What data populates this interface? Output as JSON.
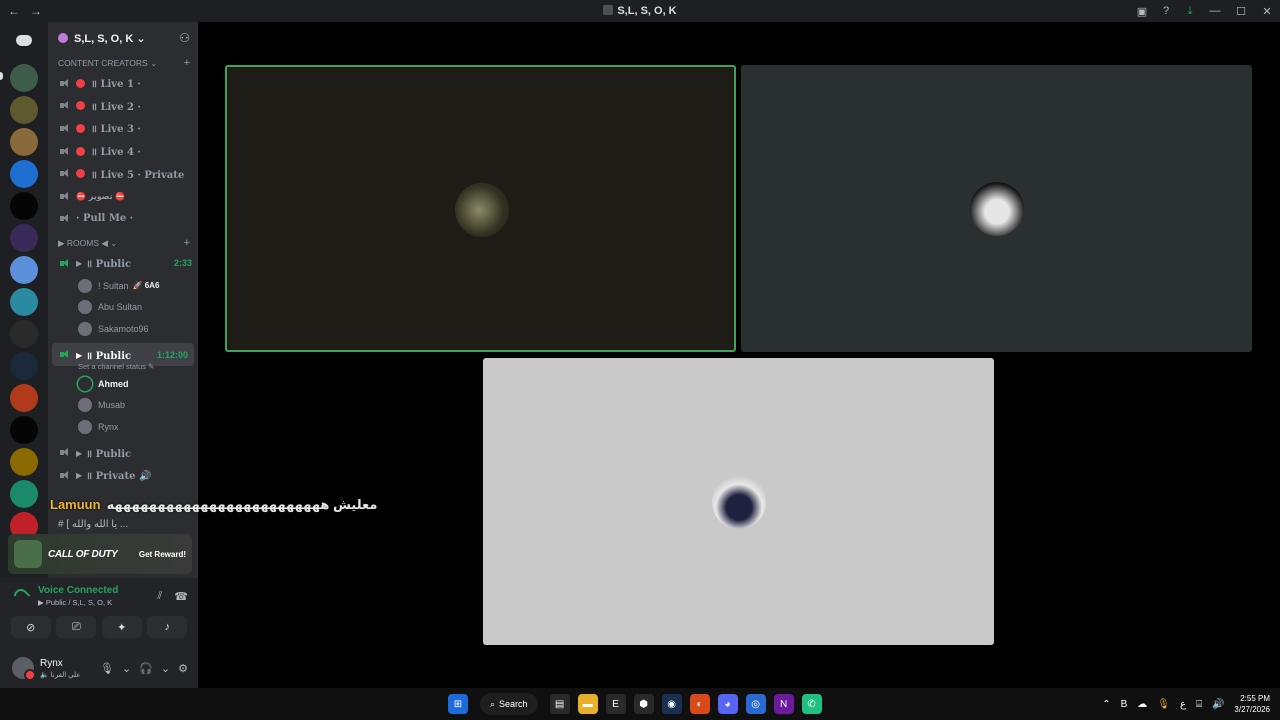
{
  "window": {
    "title": "S,L, S, O, K",
    "back": "←",
    "forward": "→",
    "top_icons": {
      "inbox": "▣",
      "help": "?",
      "download": "⤓"
    },
    "win_controls": {
      "minimize": "—",
      "maximize": "☐",
      "close": "✕"
    }
  },
  "guild": {
    "name": "S,L, S, O, K ⌄"
  },
  "categories": {
    "content": {
      "label": "CONTENT CREATORS ⌄"
    },
    "rooms": {
      "label": "▶ ROOMS ◀ ⌄"
    }
  },
  "channels_top": [
    {
      "label": "॥ Live 1 ·"
    },
    {
      "label": "॥ Live 2 ·"
    },
    {
      "label": "॥ Live 3 ·"
    },
    {
      "label": "॥ Live 4 ·"
    },
    {
      "label": "॥ Live 5 · Private"
    },
    {
      "label": "⛔ تصوير ⛔"
    },
    {
      "label": "· Pull Me ·"
    }
  ],
  "room1": {
    "label": "॥ Public",
    "time": "2:33",
    "users": [
      {
        "name": "! Sultan",
        "tag": "🚀 6A6"
      },
      {
        "name": "Abu Sultan",
        "tag": ""
      },
      {
        "name": "Sakamoto96",
        "tag": ""
      }
    ]
  },
  "room2": {
    "label": "॥ Public",
    "time": "1:12:00",
    "status": "Set a channel status ✎",
    "users": [
      {
        "name": "Ahmed"
      },
      {
        "name": "Musab"
      },
      {
        "name": "Rynx"
      }
    ]
  },
  "room3": {
    "label": "॥ Public"
  },
  "room4": {
    "label": "॥ Private 🔊"
  },
  "overlay": {
    "name": "Lamuun",
    "message": "معليش هههههههههههههههههههههههههه",
    "message2": "# [ يا الله والله ..."
  },
  "promo": {
    "brand": "CALL OF DUTY",
    "cta": "Get Reward!"
  },
  "voice": {
    "status": "Voice Connected",
    "channel": "▶ Public / S,L, S, O, K"
  },
  "user": {
    "name": "Rynx",
    "status": "🔈 علي الفرنا"
  },
  "taskbar": {
    "search": "Search",
    "lang": "ع",
    "time": "2:55 PM",
    "date": "3/27/2026"
  },
  "colors": {
    "accent_green": "#23a55a",
    "live_dot": "#f23f43",
    "speaking_border": "#3ba55c"
  }
}
